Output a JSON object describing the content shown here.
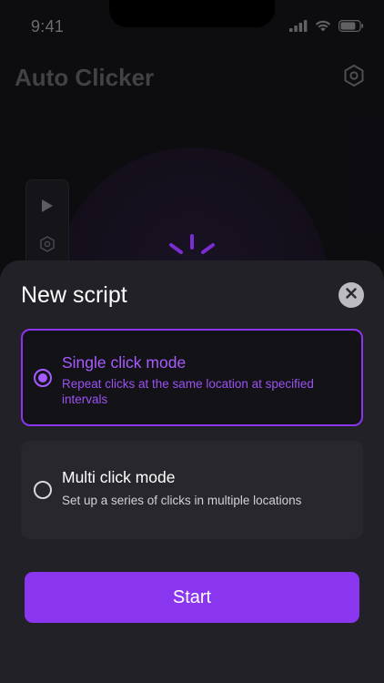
{
  "status_bar": {
    "time": "9:41"
  },
  "app": {
    "title": "Auto Clicker"
  },
  "sheet": {
    "title": "New script",
    "options": [
      {
        "title": "Single click mode",
        "description": "Repeat clicks at the same location at specified intervals",
        "selected": true
      },
      {
        "title": "Multi click mode",
        "description": "Set up a series of clicks in multiple locations",
        "selected": false
      }
    ],
    "start_label": "Start"
  },
  "colors": {
    "accent": "#8a35ee",
    "accent_text": "#a85cff",
    "sheet_background": "#222127",
    "background": "#0f0e12"
  },
  "icons": {
    "settings": "hexagon-gear-icon",
    "close": "close-icon",
    "play": "play-icon",
    "signal": "cellular-signal-icon",
    "wifi": "wifi-icon",
    "battery": "battery-icon",
    "loading": "loading-spinner-icon"
  }
}
